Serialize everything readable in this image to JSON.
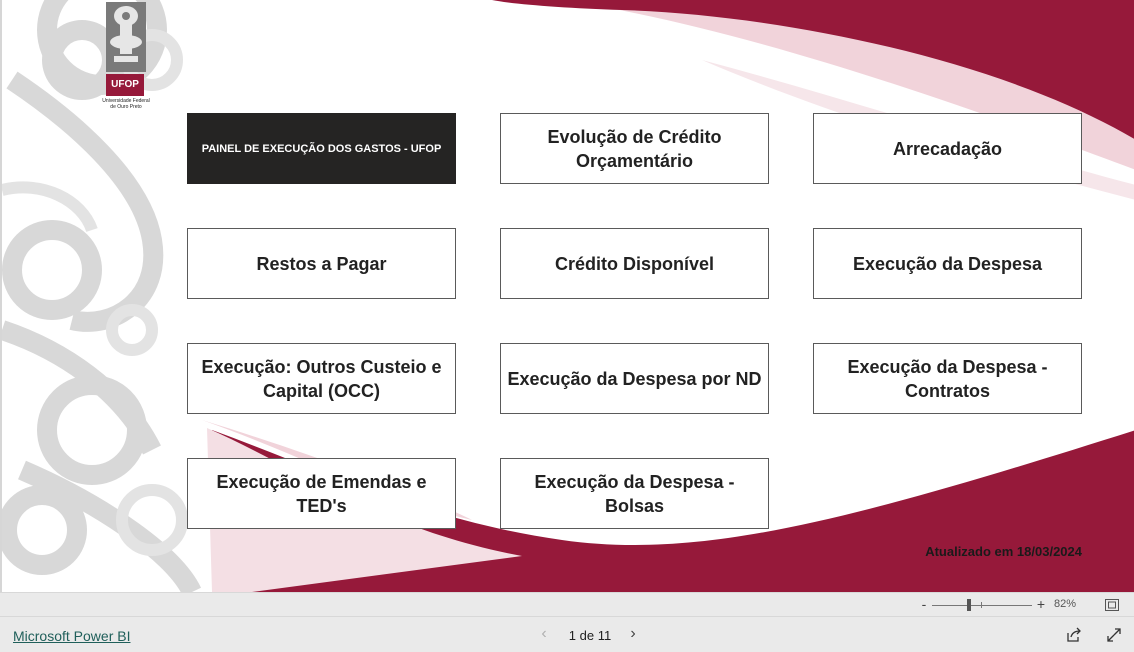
{
  "logo": {
    "badge": "UFOP",
    "caption_line1": "Universidade Federal",
    "caption_line2": "de Ouro Preto"
  },
  "tiles": [
    {
      "label": "PAINEL DE EXECUÇÃO DOS GASTOS - UFOP",
      "active": true
    },
    {
      "label": "Evolução de Crédito Orçamentário"
    },
    {
      "label": "Arrecadação"
    },
    {
      "label": "Restos a Pagar"
    },
    {
      "label": "Crédito Disponível"
    },
    {
      "label": "Execução da Despesa"
    },
    {
      "label": "Execução: Outros Custeio e Capital (OCC)"
    },
    {
      "label": "Execução da Despesa por ND"
    },
    {
      "label": "Execução da Despesa - Contratos"
    },
    {
      "label": "Execução de Emendas e TED's"
    },
    {
      "label": "Execução da Despesa - Bolsas"
    }
  ],
  "updated_text": "Atualizado em 18/03/2024",
  "zoom": {
    "minus": "-",
    "plus": "+",
    "percent_label": "82%",
    "level": 0.82
  },
  "footer": {
    "brand_link": "Microsoft Power BI",
    "page_indicator": "1 de 11",
    "prev_icon": "chevron-left-icon",
    "next_icon": "chevron-right-icon"
  },
  "colors": {
    "accent": "#96193a",
    "accent_light": "#f3dde2",
    "tile_border": "#5a5a5a",
    "tile_active": "#252423",
    "link": "#1f5f5a"
  }
}
